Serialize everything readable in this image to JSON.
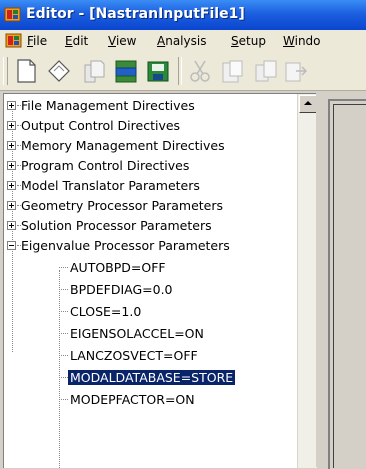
{
  "window": {
    "title": "Editor - [NastranInputFile1]"
  },
  "menu": [
    {
      "label": "File",
      "underline": "F",
      "rest": "ile"
    },
    {
      "label": "Edit",
      "underline": "E",
      "rest": "dit"
    },
    {
      "label": "View",
      "underline": "V",
      "rest": "iew"
    },
    {
      "label": "Analysis",
      "underline": "A",
      "rest": "nalysis"
    },
    {
      "label": "Setup",
      "underline": "S",
      "rest": "etup"
    },
    {
      "label": "Windo",
      "underline": "W",
      "rest": "indo"
    }
  ],
  "toolbar": {
    "buttons": [
      "new-document-icon",
      "open-icon",
      "copy-document-icon",
      "print-icon",
      "save-icon",
      "cut-icon",
      "paste-icon",
      "import-icon",
      "export-icon"
    ]
  },
  "tree": {
    "nodes": [
      {
        "label": "File Management Directives",
        "expanded": false
      },
      {
        "label": "Output Control Directives",
        "expanded": false
      },
      {
        "label": "Memory Management Directives",
        "expanded": false
      },
      {
        "label": "Program Control Directives",
        "expanded": false
      },
      {
        "label": "Model Translator Parameters",
        "expanded": false
      },
      {
        "label": "Geometry Processor Parameters",
        "expanded": false
      },
      {
        "label": "Solution Processor Parameters",
        "expanded": false
      },
      {
        "label": "Eigenvalue Processor Parameters",
        "expanded": true
      }
    ],
    "children": [
      {
        "label": "AUTOBPD=OFF"
      },
      {
        "label": "BPDEFDIAG=0.0"
      },
      {
        "label": "CLOSE=1.0"
      },
      {
        "label": "EIGENSOLACCEL=ON"
      },
      {
        "label": "LANCZOSVECT=OFF"
      },
      {
        "label": "MODALDATABASE=STORE",
        "selected": true
      },
      {
        "label": "MODEPFACTOR=ON"
      }
    ]
  },
  "colors": {
    "title_bar": "#0a46cf",
    "selection": "#0a246a"
  }
}
